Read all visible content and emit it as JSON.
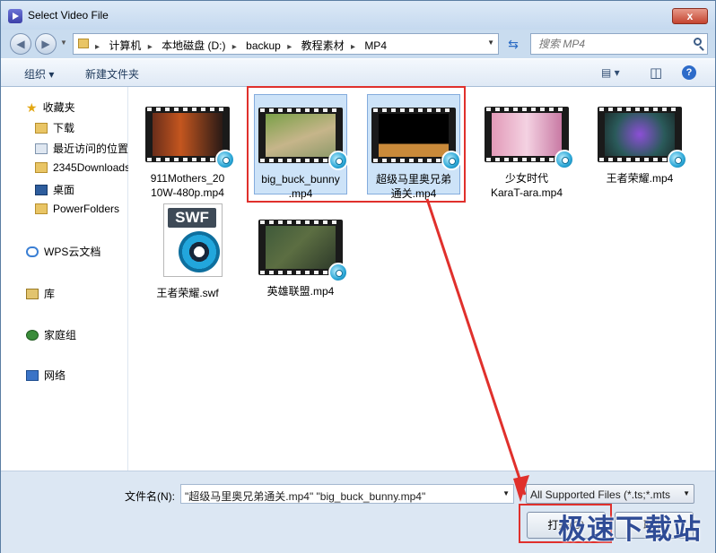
{
  "window": {
    "title": "Select Video File",
    "close_label": "x"
  },
  "nav": {
    "back_glyph": "◀",
    "forward_glyph": "▶",
    "breadcrumbs": [
      "计算机",
      "本地磁盘 (D:)",
      "backup",
      "教程素材",
      "MP4"
    ],
    "separator": "▸",
    "search_placeholder": "搜索 MP4"
  },
  "toolbar": {
    "organize": "组织 ▾",
    "new_folder": "新建文件夹",
    "view_glyph": "▤ ▾",
    "pane_glyph": "◫",
    "help": "?"
  },
  "sidebar": {
    "favorites": "收藏夹",
    "items": [
      "下载",
      "最近访问的位置",
      "2345Downloads",
      "桌面",
      "PowerFolders"
    ],
    "wps": "WPS云文档",
    "library": "库",
    "homegroup": "家庭组",
    "network": "网络"
  },
  "files": [
    {
      "name": "911Mothers_2010W-480p.mp4",
      "l1": "911Mothers_20",
      "l2": "10W-480p.mp4",
      "kind": "video",
      "selected": false
    },
    {
      "name": "big_buck_bunny.mp4",
      "l1": "big_buck_bunny",
      "l2": ".mp4",
      "kind": "video",
      "selected": true
    },
    {
      "name": "超级马里奥兄弟通关.mp4",
      "l1": "超级马里奥兄弟",
      "l2": "通关.mp4",
      "kind": "video",
      "selected": true
    },
    {
      "name": "少女时代KaraT-ara.mp4",
      "l1": "少女时代",
      "l2": "KaraT-ara.mp4",
      "kind": "video",
      "selected": false
    },
    {
      "name": "王者荣耀.mp4",
      "l1": "王者荣耀.mp4",
      "l2": "",
      "kind": "video",
      "selected": false
    },
    {
      "name": "王者荣耀.swf",
      "l1": "王者荣耀.swf",
      "l2": "",
      "kind": "swf",
      "selected": false
    },
    {
      "name": "英雄联盟.mp4",
      "l1": "英雄联盟.mp4",
      "l2": "",
      "kind": "video",
      "selected": false
    }
  ],
  "swf_tag": "SWF",
  "bottom": {
    "filename_label": "文件名(N):",
    "filename_value": "\"超级马里奥兄弟通关.mp4\" \"big_buck_bunny.mp4\"",
    "filter_value": "All Supported Files (*.ts;*.mts",
    "open_button": "打开(O)",
    "cancel_button": "取消"
  },
  "watermark": "极速下载站",
  "colors": {
    "selection_border": "#e0302c",
    "selection_fill": "#cde3f8",
    "arrow": "#e0302c"
  }
}
